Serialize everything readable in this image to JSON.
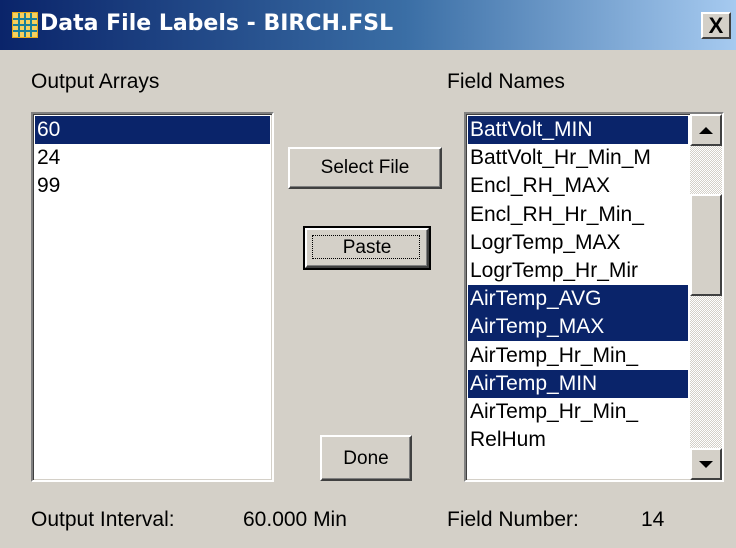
{
  "window": {
    "title": "Data File Labels - BIRCH.FSL",
    "close_glyph": "X"
  },
  "output_arrays": {
    "label": "Output Arrays",
    "items": [
      {
        "text": "60",
        "selected": true
      },
      {
        "text": "24",
        "selected": false
      },
      {
        "text": "99",
        "selected": false
      }
    ]
  },
  "field_names": {
    "label": "Field Names",
    "items": [
      {
        "text": "BattVolt_MIN",
        "selected": true
      },
      {
        "text": "BattVolt_Hr_Min_M",
        "selected": false
      },
      {
        "text": "Encl_RH_MAX",
        "selected": false
      },
      {
        "text": "Encl_RH_Hr_Min_",
        "selected": false
      },
      {
        "text": "LogrTemp_MAX",
        "selected": false
      },
      {
        "text": "LogrTemp_Hr_Mir",
        "selected": false
      },
      {
        "text": "AirTemp_AVG",
        "selected": true
      },
      {
        "text": "AirTemp_MAX",
        "selected": true
      },
      {
        "text": "AirTemp_Hr_Min_",
        "selected": false
      },
      {
        "text": "AirTemp_MIN",
        "selected": true
      },
      {
        "text": "AirTemp_Hr_Min_",
        "selected": false
      },
      {
        "text": "RelHum",
        "selected": false
      }
    ]
  },
  "buttons": {
    "select_file": "Select File",
    "paste": "Paste",
    "done": "Done"
  },
  "footer": {
    "output_interval_label": "Output Interval:",
    "output_interval_value": "60.000 Min",
    "field_number_label": "Field Number:",
    "field_number_value": "14"
  },
  "colors": {
    "selection": "#0a246a",
    "dialog_bg": "#d4d0c8",
    "title_start": "#0a246a",
    "title_end": "#a6caf0"
  },
  "icons": {
    "app": "table-grid-icon",
    "close": "close-icon",
    "scroll_up": "arrow-up-icon",
    "scroll_down": "arrow-down-icon"
  }
}
